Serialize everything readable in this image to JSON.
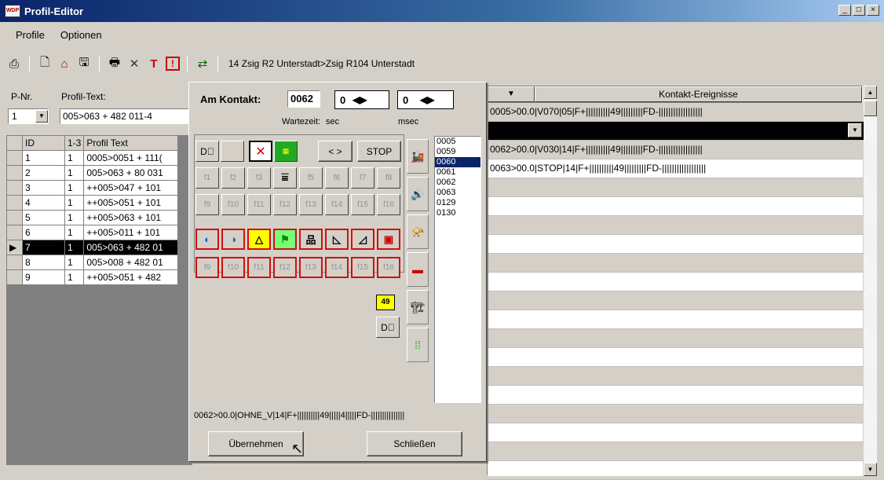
{
  "window": {
    "title": "Profil-Editor",
    "icon": "WDP"
  },
  "menu": {
    "items": [
      "Profile",
      "Optionen"
    ]
  },
  "toolbar": {
    "icons": [
      "print-preview-icon",
      "new-icon",
      "house-icon",
      "save-icon",
      "printer-icon",
      "delete-icon",
      "t-icon",
      "alert-icon",
      "route-icon"
    ],
    "route_text": "14 Zsig R2 Unterstadt>Zsig R104 Unterstadt"
  },
  "left": {
    "pnr_label": "P-Nr.",
    "pnr_value": "1",
    "profiltext_label": "Profil-Text:",
    "profiltext_value": "005>063 + 482 011-4",
    "columns": [
      "ID",
      "1-3",
      "Profil Text"
    ],
    "rows": [
      {
        "id": "1",
        "c13": "1",
        "text": "0005>0051 + 111(",
        "selected": false
      },
      {
        "id": "2",
        "c13": "1",
        "text": "005>063 + 80 031",
        "selected": false
      },
      {
        "id": "3",
        "c13": "1",
        "text": "++005>047 + 101",
        "selected": false
      },
      {
        "id": "4",
        "c13": "1",
        "text": "++005>051 + 101",
        "selected": false
      },
      {
        "id": "5",
        "c13": "1",
        "text": "++005>063 + 101",
        "selected": false
      },
      {
        "id": "6",
        "c13": "1",
        "text": "++005>011 + 101",
        "selected": false
      },
      {
        "id": "7",
        "c13": "1",
        "text": "005>063 + 482 01",
        "selected": true
      },
      {
        "id": "8",
        "c13": "1",
        "text": "005>008 + 482 01",
        "selected": false
      },
      {
        "id": "9",
        "c13": "1",
        "text": "++005>051 + 482",
        "selected": false
      }
    ]
  },
  "dialog": {
    "am_kontakt_label": "Am Kontakt:",
    "kontakt_value": "0062",
    "spin1_value": "0",
    "spin2_value": "0",
    "wartezeit_label": "Wartezeit:",
    "sec_label": "sec",
    "msec_label": "msec",
    "arrows_label": "< >",
    "stop_label": "STOP",
    "fkeys_row1": [
      "f1",
      "f2",
      "f3",
      "",
      "f5",
      "f6",
      "f7",
      "f8"
    ],
    "fkeys_row2": [
      "f9",
      "f10",
      "f11",
      "f12",
      "f13",
      "f14",
      "f15",
      "f16"
    ],
    "fkeys_row3": [
      "f9",
      "f10",
      "f11",
      "f12",
      "f13",
      "f14",
      "f15",
      "f16"
    ],
    "speed_badge": "49",
    "contacts": [
      "0005",
      "0059",
      "0060",
      "0061",
      "0062",
      "0063",
      "0129",
      "0130"
    ],
    "selected_contact": "0060",
    "status_line": "0062>00.0|OHNE_V|14|F+||||||||||49|||||4|||||FD-|||||||||||||||",
    "apply_button": "Übernehmen",
    "close_button": "Schließen"
  },
  "right": {
    "header": "Kontakt-Ereignisse",
    "rows": [
      "0005>00.0|V070|05|F+||||||||||49|||||||||FD-||||||||||||||||||",
      "",
      "0062>00.0|V030|14|F+||||||||||49|||||||||FD-||||||||||||||||||",
      "0063>00.0|STOP|14|F+||||||||||49|||||||||FD-||||||||||||||||||"
    ]
  }
}
